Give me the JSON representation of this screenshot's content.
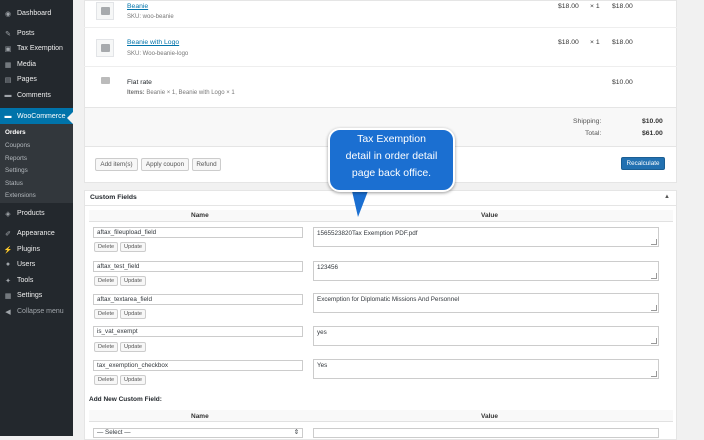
{
  "sidebar": {
    "items": [
      {
        "label": "Dashboard",
        "icon": "dashboard-icon",
        "glyph": "◉"
      },
      {
        "label": "Posts",
        "icon": "pin-icon",
        "glyph": "✎"
      },
      {
        "label": "Tax Exemption",
        "icon": "tax-exemption-icon",
        "glyph": "▣"
      },
      {
        "label": "Media",
        "icon": "media-icon",
        "glyph": "▦"
      },
      {
        "label": "Pages",
        "icon": "pages-icon",
        "glyph": "▤"
      },
      {
        "label": "Comments",
        "icon": "comments-icon",
        "glyph": "▬"
      },
      {
        "label": "WooCommerce",
        "icon": "woocommerce-icon",
        "glyph": "▬"
      }
    ],
    "submenu": [
      "Orders",
      "Coupons",
      "Reports",
      "Settings",
      "Status",
      "Extensions"
    ],
    "items_lower": [
      {
        "label": "Products",
        "icon": "products-icon",
        "glyph": "◈"
      },
      {
        "label": "Appearance",
        "icon": "appearance-icon",
        "glyph": "✐"
      },
      {
        "label": "Plugins",
        "icon": "plugins-icon",
        "glyph": "⚡"
      },
      {
        "label": "Users",
        "icon": "users-icon",
        "glyph": "●"
      },
      {
        "label": "Tools",
        "icon": "tools-icon",
        "glyph": "✦"
      },
      {
        "label": "Settings",
        "icon": "settings-icon",
        "glyph": "▦"
      },
      {
        "label": "Collapse menu",
        "icon": "collapse-icon",
        "glyph": "◀"
      }
    ]
  },
  "order_items": [
    {
      "name": "Beanie",
      "sku": "SKU: woo-beanie",
      "cost": "$18.00",
      "qty": "× 1",
      "total": "$18.00"
    },
    {
      "name": "Beanie with Logo",
      "sku": "SKU: Woo-beanie-logo",
      "cost": "$18.00",
      "qty": "× 1",
      "total": "$18.00"
    }
  ],
  "shipping_line": {
    "name": "Flat rate",
    "items_label": "Items:",
    "items_value": "Beanie × 1, Beanie with Logo × 1",
    "total": "$10.00"
  },
  "totals": {
    "shipping_label": "Shipping:",
    "shipping_value": "$10.00",
    "total_label": "Total:",
    "total_value": "$61.00"
  },
  "actions": {
    "add_items": "Add item(s)",
    "apply_coupon": "Apply coupon",
    "refund": "Refund",
    "recalculate": "Recalculate"
  },
  "custom_fields": {
    "title": "Custom Fields",
    "col_name": "Name",
    "col_value": "Value",
    "delete_label": "Delete",
    "update_label": "Update",
    "rows": [
      {
        "key": "aftax_fileupload_field",
        "value": "1565523820Tax Exemption PDF.pdf"
      },
      {
        "key": "aftax_test_field",
        "value": "123456"
      },
      {
        "key": "aftax_textarea_field",
        "value": "Excemption for Diplomatic Missions And Personnel"
      },
      {
        "key": "is_vat_exempt",
        "value": "yes"
      },
      {
        "key": "tax_exemption_checkbox",
        "value": "Yes"
      }
    ],
    "add_new_title": "Add New Custom Field:",
    "new_name_header": "Name",
    "new_value_header": "Value",
    "select_placeholder": "— Select —"
  },
  "callout": {
    "line1": "Tax Exemption",
    "line2": "detail in order detail",
    "line3": "page back office."
  },
  "colors": {
    "sidebar": "#23282d",
    "active": "#0073aa",
    "callout": "#1b6fd1",
    "primary_button": "#2271b1"
  }
}
